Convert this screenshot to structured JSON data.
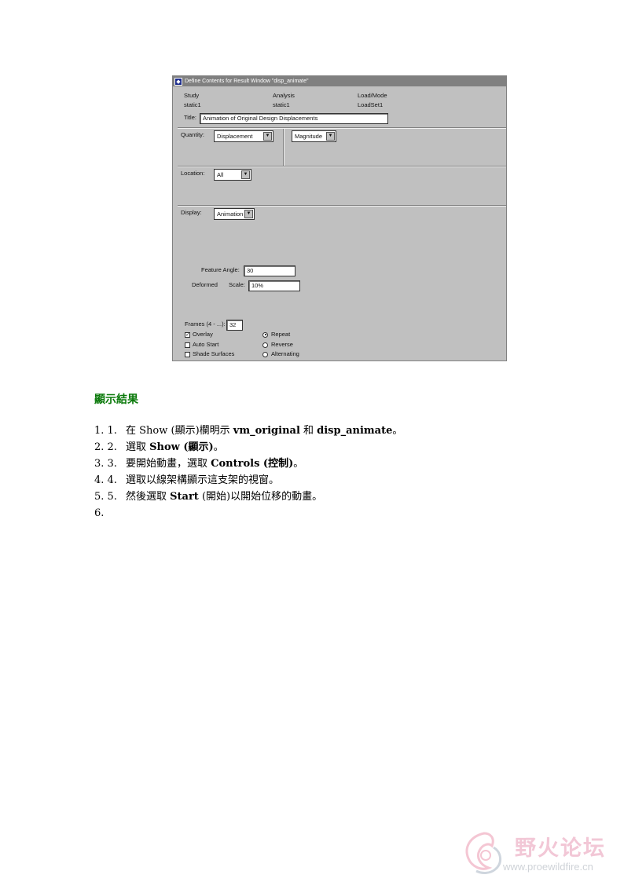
{
  "dialog": {
    "window_title": "Define Contents for Result Window \"disp_animate\"",
    "study_label": "Study",
    "study_value": "static1",
    "analysis_label": "Analysis",
    "analysis_value": "static1",
    "loadmode_label": "Load/Mode",
    "loadmode_value": "LoadSet1",
    "title_label": "Title:",
    "title_value": "Animation of Original Design Displacements",
    "quantity_label": "Quantity:",
    "quantity_value": "Displacement",
    "component_value": "Magnitude",
    "location_label": "Location:",
    "location_value": "All",
    "display_label": "Display:",
    "display_value": "Animation",
    "feature_angle_label": "Feature Angle:",
    "feature_angle_value": "30",
    "deformed_label": "Deformed",
    "scale_label": "Scale:",
    "scale_value": "10%",
    "frames_label": "Frames (4 - ...):",
    "frames_value": "32",
    "overlay_label": "Overlay",
    "auto_start_label": "Auto Start",
    "shade_surfaces_label": "Shade Surfaces",
    "repeat_label": "Repeat",
    "reverse_label": "Reverse",
    "alternating_label": "Alternating"
  },
  "doc": {
    "heading": "顯示結果",
    "steps": [
      {
        "num": "1.  1.",
        "pre": "在 Show (顯示)欄明示 ",
        "bold": "vm_original",
        "mid": " 和 ",
        "bold2": "disp_animate",
        "post": "。"
      },
      {
        "num": "2.  2.",
        "pre": "選取 ",
        "bold": "Show (顯示)",
        "post": "。"
      },
      {
        "num": "3.  3.",
        "pre": "要開始動畫，選取 ",
        "bold": "Controls (控制)",
        "post": "。"
      },
      {
        "num": "4.  4.",
        "pre": "選取以線架構顯示這支架的視窗。"
      },
      {
        "num": "5.  5.",
        "pre": "然後選取 ",
        "bold": "Start",
        "post": " (開始)以開始位移的動畫。"
      },
      {
        "num": "6."
      }
    ]
  },
  "watermark": {
    "title": "野火论坛",
    "url": "www.proewildfire.cn"
  },
  "colors": {
    "heading": "#0b7a0b",
    "dialog_bg": "#c0c0c0",
    "titlebar": "#808080"
  }
}
